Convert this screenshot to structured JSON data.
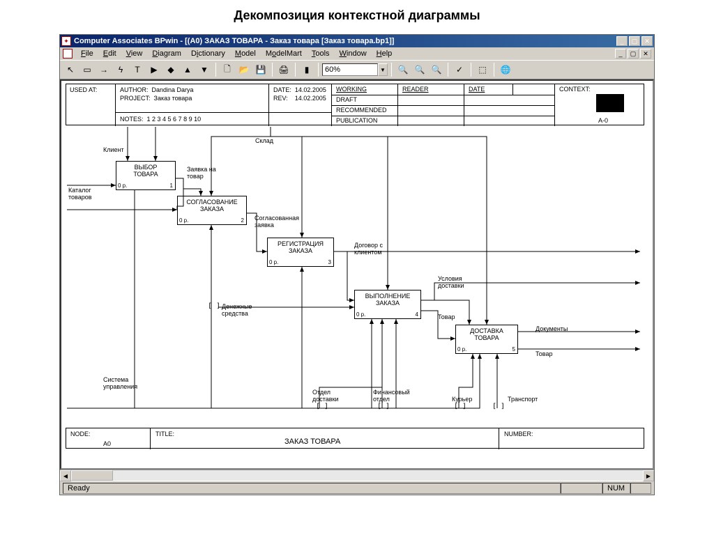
{
  "page_title": "Декомпозиция контекстной диаграммы",
  "window": {
    "title": "Computer Associates BPwin - [(A0) ЗАКАЗ ТОВАРА  - Заказ товара  [Заказ товара.bp1]]"
  },
  "menu": {
    "file": "File",
    "edit": "Edit",
    "view": "View",
    "diagram": "Diagram",
    "dictionary": "Dictionary",
    "model": "Model",
    "modelmart": "ModelMart",
    "tools": "Tools",
    "window": "Window",
    "help": "Help"
  },
  "toolbar": {
    "zoom": "60%"
  },
  "header": {
    "used_at": "USED AT:",
    "author_l": "AUTHOR:",
    "author": "Dandina Darya",
    "date_l": "DATE:",
    "date": "14.02.2005",
    "project_l": "PROJECT:",
    "project": "Заказ товара",
    "rev_l": "REV:",
    "rev": "14.02.2005",
    "notes_l": "NOTES:",
    "notes": "1  2  3  4  5  6  7  8  9  10",
    "working": "WORKING",
    "draft": "DRAFT",
    "recommended": "RECOMMENDED",
    "publication": "PUBLICATION",
    "reader": "READER",
    "hdate": "DATE",
    "context": "CONTEXT:",
    "context_code": "A-0"
  },
  "activities": {
    "a1": {
      "t1": "ВЫБОР",
      "t2": "ТОВАРА",
      "cost": "0 р.",
      "num": "1"
    },
    "a2": {
      "t1": "СОГЛАСОВАНИЕ",
      "t2": "ЗАКАЗА",
      "cost": "0 р.",
      "num": "2"
    },
    "a3": {
      "t1": "РЕГИСТРАЦИЯ",
      "t2": "ЗАКАЗА",
      "cost": "0 р.",
      "num": "3"
    },
    "a4": {
      "t1": "ВЫПОЛНЕНИЕ",
      "t2": "ЗАКАЗА",
      "cost": "0 р.",
      "num": "4"
    },
    "a5": {
      "t1": "ДОСТАВКА",
      "t2": "ТОВАРА",
      "cost": "0 р.",
      "num": "5"
    }
  },
  "labels": {
    "klient": "Клиент",
    "sklad": "Склад",
    "zayavka": "Заявка на",
    "zayavka2": "товар",
    "katalog": "Каталог",
    "katalog2": "товаров",
    "sogl1": "Согласованная",
    "sogl2": "заявка",
    "dogovor1": "Договор с",
    "dogovor2": "клиентом",
    "uslov1": "Условия",
    "uslov2": "доставки",
    "dokumenty": "Документы",
    "tovar": "Товар",
    "tovar_out": "Товар",
    "dener1": "Денежные",
    "dener2": "средства",
    "sistema1": "Система",
    "sistema2": "управления",
    "otdel1": "Отдел",
    "otdel2": "доставки",
    "fin1": "Финансовый",
    "fin2": "отдел",
    "kurer": "Курьер",
    "transport": "Транспорт",
    "tunnel": "[ ]"
  },
  "footer": {
    "node_l": "NODE:",
    "node": "A0",
    "title_l": "TITLE:",
    "title": "ЗАКАЗ ТОВАРА",
    "number_l": "NUMBER:"
  },
  "status": {
    "ready": "Ready",
    "num": "NUM"
  }
}
